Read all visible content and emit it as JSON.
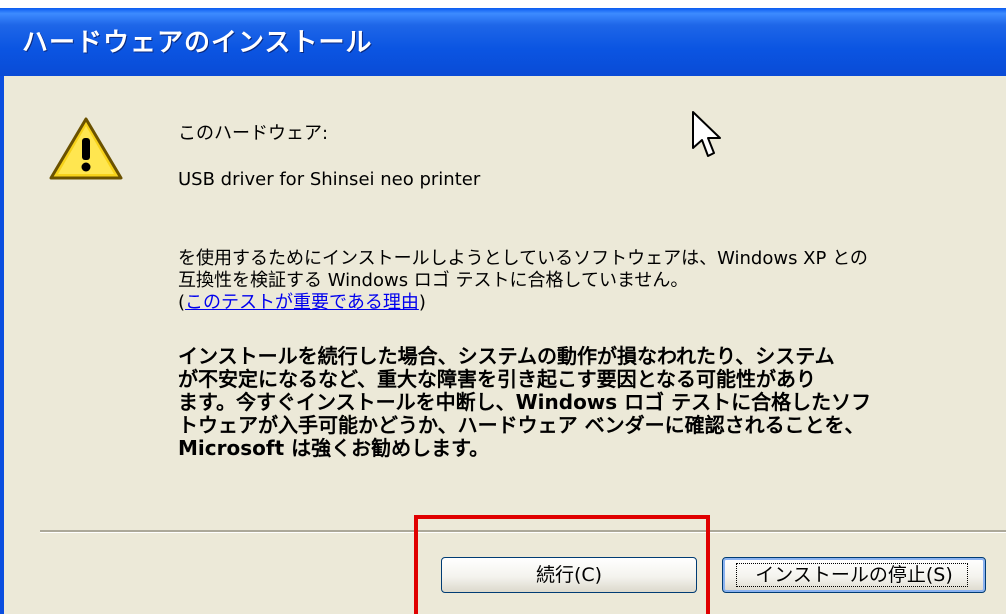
{
  "window": {
    "title": "ハードウェアのインストール"
  },
  "content": {
    "hardware_label": "このハードウェア:",
    "device_name": "USB driver for Shinsei neo printer",
    "compat_line1": "を使用するためにインストールしようとしているソフトウェアは、Windows XP との",
    "compat_line2": "互換性を検証する Windows ロゴ テストに合格していません。",
    "link_open": "(",
    "link_text": "このテストが重要である理由",
    "link_close": ")",
    "warning_line1": "インストールを続行した場合、システムの動作が損なわれたり、システム",
    "warning_line2": "が不安定になるなど、重大な障害を引き起こす要因となる可能性があり",
    "warning_line3": "ます。今すぐインストールを中断し、Windows ロゴ テストに合格したソフ",
    "warning_line4": "トウェアが入手可能かどうか、ハードウェア ベンダーに確認されることを、",
    "warning_line5": "Microsoft は強くお勧めします。"
  },
  "buttons": {
    "continue_label": "続行(C)",
    "stop_label": "インストールの停止(S)"
  },
  "colors": {
    "titlebar": "#0a4ee0",
    "dialog_bg": "#ece9d8",
    "highlight": "#e00000",
    "link": "#0000ee"
  },
  "icons": [
    "warning-icon",
    "mouse-cursor-icon"
  ]
}
